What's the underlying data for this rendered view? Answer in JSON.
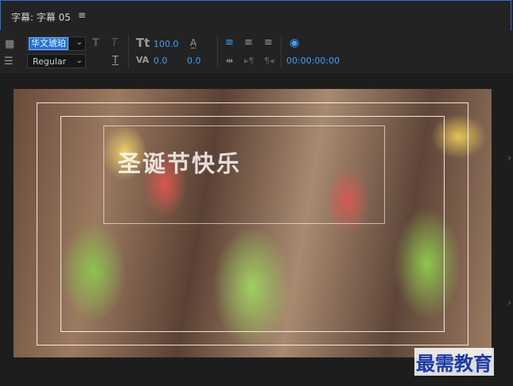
{
  "panel": {
    "title": "字幕: 字幕 05",
    "menu_icon": "hamburger-icon"
  },
  "toolbar": {
    "font_family": "华文琥珀",
    "font_style": "Regular",
    "font_size": "100.0",
    "kerning": "0.0",
    "tracking": "0.0",
    "timecode": "00:00:00:00"
  },
  "caption": {
    "text": "圣诞节快乐"
  },
  "watermark": {
    "text": "最需教育"
  }
}
